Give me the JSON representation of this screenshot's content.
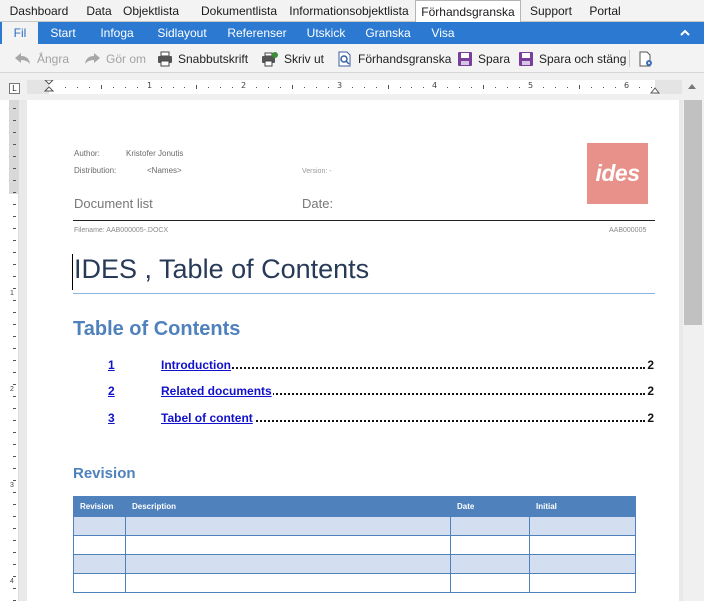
{
  "app_nav": {
    "tabs": [
      {
        "label": "Dashboard"
      },
      {
        "label": "Data"
      },
      {
        "label": "Objektlista"
      },
      {
        "label": "Dokumentlista"
      },
      {
        "label": "Informationsobjektlista"
      },
      {
        "label": "Förhandsgranska",
        "active": true
      },
      {
        "label": "Support"
      },
      {
        "label": "Portal"
      }
    ]
  },
  "ribbon": {
    "tabs": [
      {
        "label": "Fil",
        "active": true
      },
      {
        "label": "Start"
      },
      {
        "label": "Infoga"
      },
      {
        "label": "Sidlayout"
      },
      {
        "label": "Referenser"
      },
      {
        "label": "Utskick"
      },
      {
        "label": "Granska"
      },
      {
        "label": "Visa"
      }
    ],
    "collapse_icon": "chevron-up-icon"
  },
  "toolbar": {
    "undo": "Ångra",
    "redo": "Gör om",
    "quick_print": "Snabbutskrift",
    "print": "Skriv ut",
    "preview": "Förhandsgranska",
    "save": "Spara",
    "save_close": "Spara och stäng"
  },
  "ruler": {
    "corner_label": "L",
    "numbers": [
      "1",
      "2",
      "3",
      "4",
      "5",
      "6"
    ],
    "vertical_numbers": [
      "1",
      "2",
      "3",
      "4"
    ]
  },
  "document": {
    "header": {
      "author_label": "Author:",
      "author_value": "Kristofer Jonutis",
      "distribution_label": "Distribution:",
      "distribution_value": "<Names>",
      "version_label": "Version: -",
      "doc_type": "Document list",
      "date_label": "Date:",
      "filename": "Filename: AAB000005-.DOCX",
      "doc_id": "AAB000005",
      "logo_text": "ides"
    },
    "title": "IDES , Table of Contents",
    "toc_heading": "Table of Contents",
    "toc": [
      {
        "num": "1",
        "title": "Introduction",
        "page": "2"
      },
      {
        "num": "2",
        "title": "Related documents",
        "page": "2"
      },
      {
        "num": "3",
        "title": "Tabel of content",
        "page": "2"
      }
    ],
    "revision_heading": "Revision",
    "revision_table": {
      "headers": [
        "Revision",
        "Description",
        "Date",
        "Initial"
      ],
      "row_count": 4
    }
  },
  "colors": {
    "ribbon_blue": "#2b79d1",
    "heading_blue": "#4f81bd",
    "link_blue": "#1111cc",
    "logo_pink": "#e8918a"
  }
}
